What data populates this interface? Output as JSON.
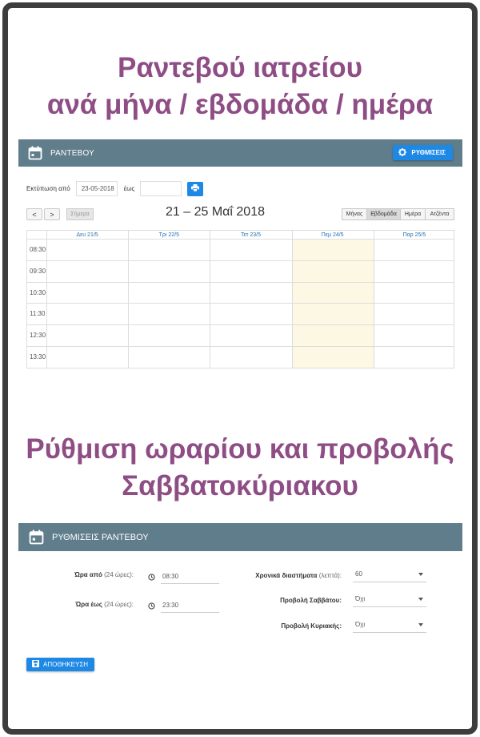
{
  "headings": {
    "calendar_line1": "Ραντεβού ιατρείου",
    "calendar_line2": "ανά μήνα / εβδομάδα / ημέρα",
    "settings_line1": "Ρύθμιση ωραρίου και προβολής",
    "settings_line2": "Σαββατοκύριακου"
  },
  "calendar": {
    "header_title": "ΡΑΝΤΕΒΟΥ",
    "settings_button": "ΡΥΘΜΙΣΕΙΣ",
    "print_from_label": "Εκτύπωση από",
    "print_from_value": "23-05-2018",
    "print_to_label": "έως",
    "print_to_value": "",
    "prev": "<",
    "next": ">",
    "today": "Σήμερα",
    "range_title": "21 – 25 Μαΐ 2018",
    "views": [
      "Μήνας",
      "Εβδομάδα",
      "Ημέρα",
      "Ατζέντα"
    ],
    "active_view": "Εβδομάδα",
    "days": [
      "Δευ 21/5",
      "Τρι 22/5",
      "Τετ 23/5",
      "Πεμ 24/5",
      "Παρ 25/5"
    ],
    "highlighted_day": "Πεμ 24/5",
    "times": [
      "08:30",
      "09:30",
      "10:30",
      "11:30",
      "12:30",
      "13:30"
    ]
  },
  "settings": {
    "header_title": "ΡΥΘΜΙΣΕΙΣ ΡΑΝΤΕΒΟΥ",
    "from_label": "Ώρα από",
    "from_hint": "(24 ώρες):",
    "from_value": "08:30",
    "to_label": "Ώρα έως",
    "to_hint": "(24 ώρες):",
    "to_value": "23:30",
    "interval_label": "Χρονικά διαστήματα",
    "interval_hint": "(λεπτά):",
    "interval_value": "60",
    "saturday_label": "Προβολή Σαββάτου:",
    "saturday_value": "Όχι",
    "sunday_label": "Προβολή Κυριακής:",
    "sunday_value": "Όχι",
    "save_button": "ΑΠΟΘΗΚΕΥΣΗ"
  },
  "colors": {
    "headline": "#8e4d84",
    "panel_header": "#607d8b",
    "accent": "#1e88e5",
    "today_highlight": "#fcf8e3"
  }
}
